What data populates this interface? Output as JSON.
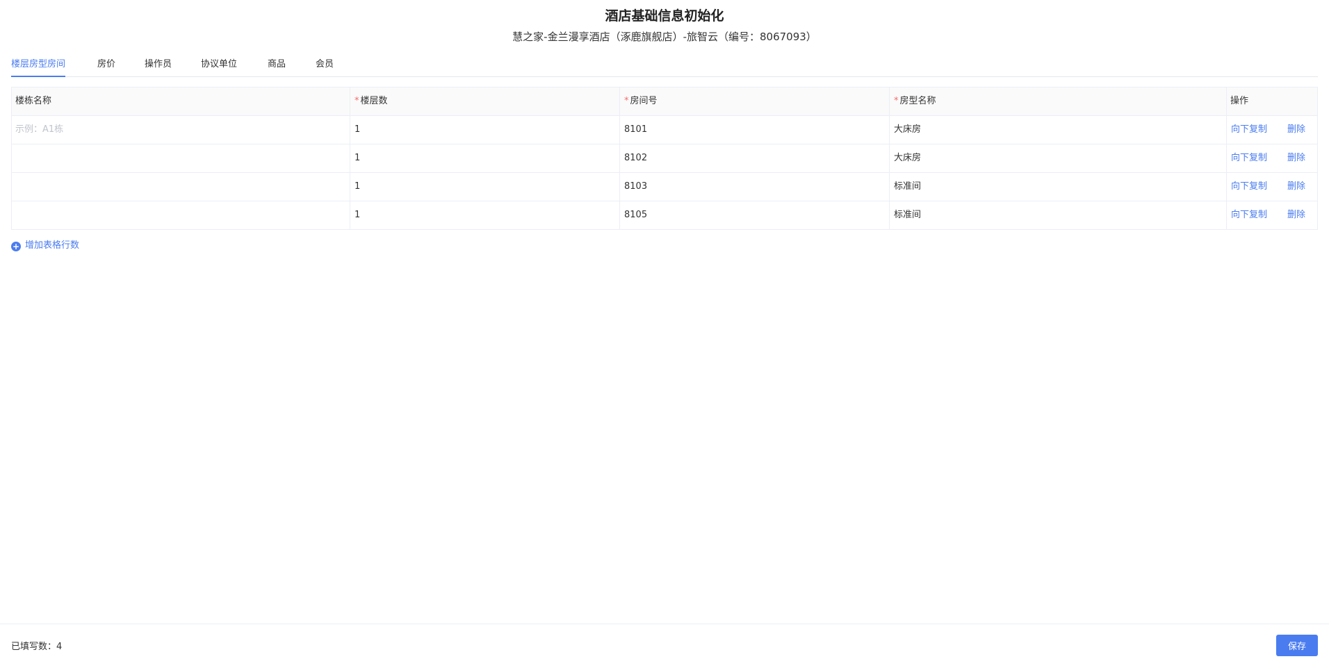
{
  "header": {
    "title": "酒店基础信息初始化",
    "subtitle": "慧之家-金兰漫享酒店（涿鹿旗舰店）-旅智云（编号：8067093）"
  },
  "tabs": [
    {
      "label": "楼层房型房间",
      "active": true
    },
    {
      "label": "房价",
      "active": false
    },
    {
      "label": "操作员",
      "active": false
    },
    {
      "label": "协议单位",
      "active": false
    },
    {
      "label": "商品",
      "active": false
    },
    {
      "label": "会员",
      "active": false
    }
  ],
  "table": {
    "columns": {
      "building": "楼栋名称",
      "floor": "楼层数",
      "room": "房间号",
      "room_type": "房型名称",
      "ops": "操作"
    },
    "required_mark": "*",
    "building_placeholder": "示例：A1栋",
    "rows": [
      {
        "building": "",
        "floor": "1",
        "room": "8101",
        "room_type": "大床房"
      },
      {
        "building": "",
        "floor": "1",
        "room": "8102",
        "room_type": "大床房"
      },
      {
        "building": "",
        "floor": "1",
        "room": "8103",
        "room_type": "标准间"
      },
      {
        "building": "",
        "floor": "1",
        "room": "8105",
        "room_type": "标准间"
      }
    ],
    "op_copy": "向下复制",
    "op_delete": "删除"
  },
  "add_row": {
    "icon": "plus-circle-icon",
    "label": "增加表格行数"
  },
  "footer": {
    "filled_label": "已填写数：",
    "filled_count": "4",
    "save_label": "保存"
  },
  "colors": {
    "accent": "#4a7cf0",
    "required": "#f56c6c",
    "placeholder": "#c0c4cc"
  }
}
